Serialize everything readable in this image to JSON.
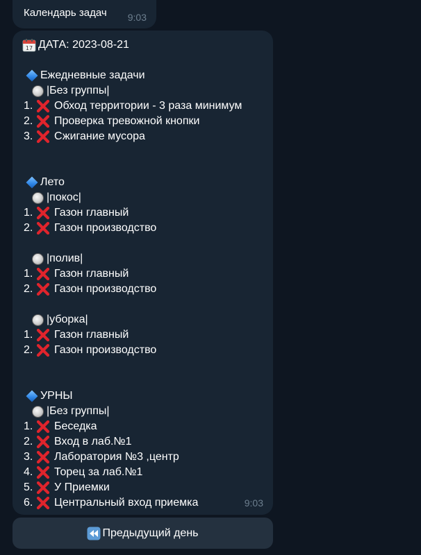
{
  "header_message": {
    "text": "Календарь задач",
    "time": "9:03"
  },
  "message": {
    "date_label": "ДАТА: 2023-08-21",
    "time": "9:03",
    "categories": [
      {
        "title": "Ежедневные задачи",
        "groups": [
          {
            "name": "|Без группы|",
            "tasks": [
              {
                "num": "1.",
                "text": "Обход территории - 3 раза минимум"
              },
              {
                "num": "2.",
                "text": "Проверка тревожной кнопки"
              },
              {
                "num": "3.",
                "text": "Сжигание мусора"
              }
            ]
          }
        ]
      },
      {
        "title": "Лето",
        "groups": [
          {
            "name": "|покос|",
            "tasks": [
              {
                "num": "1.",
                "text": "Газон главный"
              },
              {
                "num": "2.",
                "text": "Газон производство"
              }
            ]
          },
          {
            "name": "|полив|",
            "tasks": [
              {
                "num": "1.",
                "text": "Газон главный"
              },
              {
                "num": "2.",
                "text": "Газон производство"
              }
            ]
          },
          {
            "name": "|уборка|",
            "tasks": [
              {
                "num": "1.",
                "text": "Газон главный"
              },
              {
                "num": "2.",
                "text": "Газон производство"
              }
            ]
          }
        ]
      },
      {
        "title": "УРНЫ",
        "groups": [
          {
            "name": "|Без группы|",
            "tasks": [
              {
                "num": "1.",
                "text": "Беседка"
              },
              {
                "num": "2.",
                "text": "Вход в лаб.№1"
              },
              {
                "num": "3.",
                "text": "Лаборатория №3 ,центр"
              },
              {
                "num": "4.",
                "text": "Торец за лаб.№1"
              },
              {
                "num": "5.",
                "text": "У Приемки"
              },
              {
                "num": "6.",
                "text": "Центральный вход приемка"
              }
            ]
          }
        ]
      }
    ]
  },
  "nav": {
    "prev_day_label": "Предыдущий день"
  },
  "icons": {
    "date": "calendar-icon",
    "category": "blue-diamond-icon",
    "group": "white-circle-icon",
    "task_status": "cross-mark-icon",
    "prev": "rewind-icon"
  },
  "colors": {
    "background": "#0e1621",
    "bubble": "#182533",
    "button": "#24313f",
    "time_text": "#6d7f8f",
    "cross": "#e0242c",
    "diamond": "#2f86e6"
  }
}
